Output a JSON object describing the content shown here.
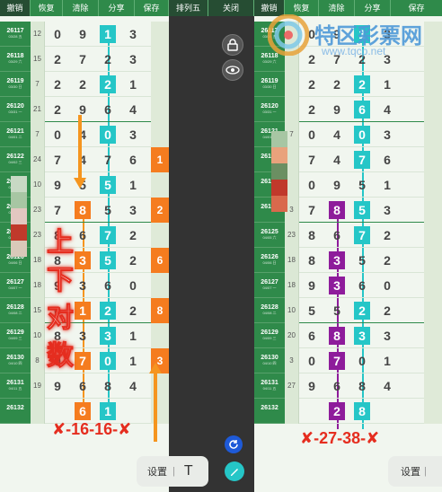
{
  "toolbar": {
    "buttons": [
      "撤销",
      "恢复",
      "清除",
      "分享",
      "保存",
      "排列五",
      "关闭",
      "撤销",
      "恢复",
      "清除",
      "分享",
      "保存"
    ]
  },
  "watermark": {
    "title": "特区彩票网",
    "url": "www.tqcp.net"
  },
  "left": {
    "rows": [
      {
        "id": "26117",
        "sub": "03/28 五",
        "sm": "12",
        "d": [
          "0",
          "9",
          "1",
          "3"
        ]
      },
      {
        "id": "26118",
        "sub": "03/29 六",
        "sm": "15",
        "d": [
          "2",
          "7",
          "2",
          "3"
        ]
      },
      {
        "id": "26119",
        "sub": "03/30 日",
        "sm": "7",
        "d": [
          "2",
          "2",
          "2",
          "1"
        ]
      },
      {
        "id": "26120",
        "sub": "03/31 一",
        "sm": "21",
        "d": [
          "2",
          "9",
          "6",
          "4"
        ]
      },
      {
        "id": "26121",
        "sub": "04/01 二",
        "sm": "7",
        "d": [
          "0",
          "4",
          "0",
          "3"
        ]
      },
      {
        "id": "26122",
        "sub": "04/02 三",
        "sm": "24",
        "d": [
          "7",
          "4",
          "7",
          "6"
        ]
      },
      {
        "id": "26123",
        "sub": "04/03 四",
        "sm": "10",
        "d": [
          "9",
          "5",
          "5",
          "1"
        ]
      },
      {
        "id": "26124",
        "sub": "04/04 五",
        "sm": "23",
        "d": [
          "7",
          "8",
          "5",
          "3"
        ]
      },
      {
        "id": "26125",
        "sub": "04/05 六",
        "sm": "23",
        "d": [
          "8",
          "6",
          "7",
          "2"
        ]
      },
      {
        "id": "26126",
        "sub": "04/06 日",
        "sm": "18",
        "d": [
          "8",
          "3",
          "5",
          "2"
        ]
      },
      {
        "id": "26127",
        "sub": "04/07 一",
        "sm": "18",
        "d": [
          "9",
          "3",
          "6",
          "0"
        ]
      },
      {
        "id": "26128",
        "sub": "04/08 二",
        "sm": "15",
        "d": [
          "0",
          "1",
          "2",
          "2"
        ]
      },
      {
        "id": "26129",
        "sub": "04/09 三",
        "sm": "10",
        "d": [
          "8",
          "3",
          "3",
          "1"
        ]
      },
      {
        "id": "26130",
        "sub": "04/10 四",
        "sm": "8",
        "d": [
          "0",
          "7",
          "0",
          "1"
        ]
      },
      {
        "id": "26131",
        "sub": "04/11 五",
        "sm": "19",
        "d": [
          "9",
          "6",
          "8",
          "4"
        ]
      },
      {
        "id": "26132",
        "sub": "",
        "sm": "",
        "d": [
          "",
          "6",
          "1",
          ""
        ]
      }
    ],
    "right_col": [
      "",
      "",
      "",
      "",
      "",
      "1",
      "",
      "2",
      "",
      "6",
      "",
      "8",
      "",
      "3",
      "",
      ""
    ],
    "annotation_cn": [
      "上",
      "下",
      "对",
      "数"
    ],
    "result": "✘-16-16-✘"
  },
  "right": {
    "rows": [
      {
        "id": "26117",
        "sub": "03/28 五",
        "sm": "",
        "d": [
          "0",
          "9",
          "1",
          "3"
        ]
      },
      {
        "id": "26118",
        "sub": "03/29 六",
        "sm": "",
        "d": [
          "2",
          "7",
          "2",
          "3"
        ]
      },
      {
        "id": "26119",
        "sub": "03/30 日",
        "sm": "",
        "d": [
          "2",
          "2",
          "2",
          "1"
        ]
      },
      {
        "id": "26120",
        "sub": "03/31 一",
        "sm": "",
        "d": [
          "2",
          "9",
          "6",
          "4"
        ]
      },
      {
        "id": "26121",
        "sub": "04/01 二",
        "sm": "7",
        "d": [
          "0",
          "4",
          "0",
          "3"
        ]
      },
      {
        "id": "26122",
        "sub": "",
        "sm": "",
        "d": [
          "7",
          "4",
          "7",
          "6"
        ]
      },
      {
        "id": "26123",
        "sub": "",
        "sm": "",
        "d": [
          "0",
          "9",
          "5",
          "1"
        ]
      },
      {
        "id": "26124",
        "sub": "",
        "sm": "3",
        "d": [
          "7",
          "8",
          "5",
          "3"
        ]
      },
      {
        "id": "26125",
        "sub": "04/05 六",
        "sm": "23",
        "d": [
          "8",
          "6",
          "7",
          "2"
        ]
      },
      {
        "id": "26126",
        "sub": "04/06 日",
        "sm": "18",
        "d": [
          "8",
          "3",
          "5",
          "2"
        ]
      },
      {
        "id": "26127",
        "sub": "04/07 一",
        "sm": "18",
        "d": [
          "9",
          "3",
          "6",
          "0"
        ]
      },
      {
        "id": "26128",
        "sub": "04/08 二",
        "sm": "10",
        "d": [
          "5",
          "5",
          "2",
          "2"
        ]
      },
      {
        "id": "26129",
        "sub": "04/09 三",
        "sm": "20",
        "d": [
          "6",
          "8",
          "3",
          "3"
        ]
      },
      {
        "id": "26130",
        "sub": "04/10 四",
        "sm": "3",
        "d": [
          "0",
          "7",
          "0",
          "1"
        ]
      },
      {
        "id": "26131",
        "sub": "04/11 五",
        "sm": "27",
        "d": [
          "9",
          "6",
          "8",
          "4"
        ]
      },
      {
        "id": "26132",
        "sub": "",
        "sm": "",
        "d": [
          "",
          "2",
          "8",
          ""
        ]
      }
    ],
    "result": "✘-27-38-✘"
  },
  "settings_label": "设置",
  "icons": [
    "lock-icon",
    "eye-icon",
    "refresh-icon",
    "pen-icon",
    "text-tool-icon"
  ]
}
